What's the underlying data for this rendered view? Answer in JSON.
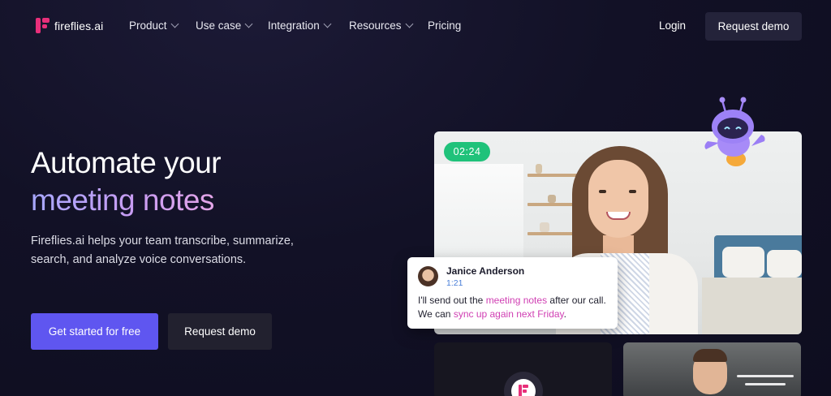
{
  "brand": {
    "name": "fireflies.ai",
    "icon": "fireflies-logo-icon",
    "color": "#e82f7a"
  },
  "nav": {
    "items": [
      {
        "label": "Product",
        "has_dropdown": true
      },
      {
        "label": "Use case",
        "has_dropdown": true
      },
      {
        "label": "Integration",
        "has_dropdown": true
      },
      {
        "label": "Resources",
        "has_dropdown": true
      },
      {
        "label": "Pricing",
        "has_dropdown": false
      }
    ],
    "login": "Login",
    "request_demo": "Request demo"
  },
  "hero": {
    "title_line1": "Automate your",
    "title_line2": "meeting notes",
    "subtitle": "Fireflies.ai helps your team transcribe, summarize, search, and analyze voice conversations.",
    "cta_primary": "Get started for free",
    "cta_secondary": "Request demo"
  },
  "video": {
    "timer": "02:24",
    "chat": {
      "name": "Janice Anderson",
      "time": "1:21",
      "msg_part1": "I'll send out the ",
      "msg_hl1": "meeting notes",
      "msg_part2": " after our call. We can ",
      "msg_hl2": "sync up again next Friday",
      "msg_part3": "."
    }
  },
  "colors": {
    "background": "#121126",
    "primary_button": "#5f56f0",
    "timer_green": "#1fc27a",
    "highlight": "#d03fb3"
  }
}
